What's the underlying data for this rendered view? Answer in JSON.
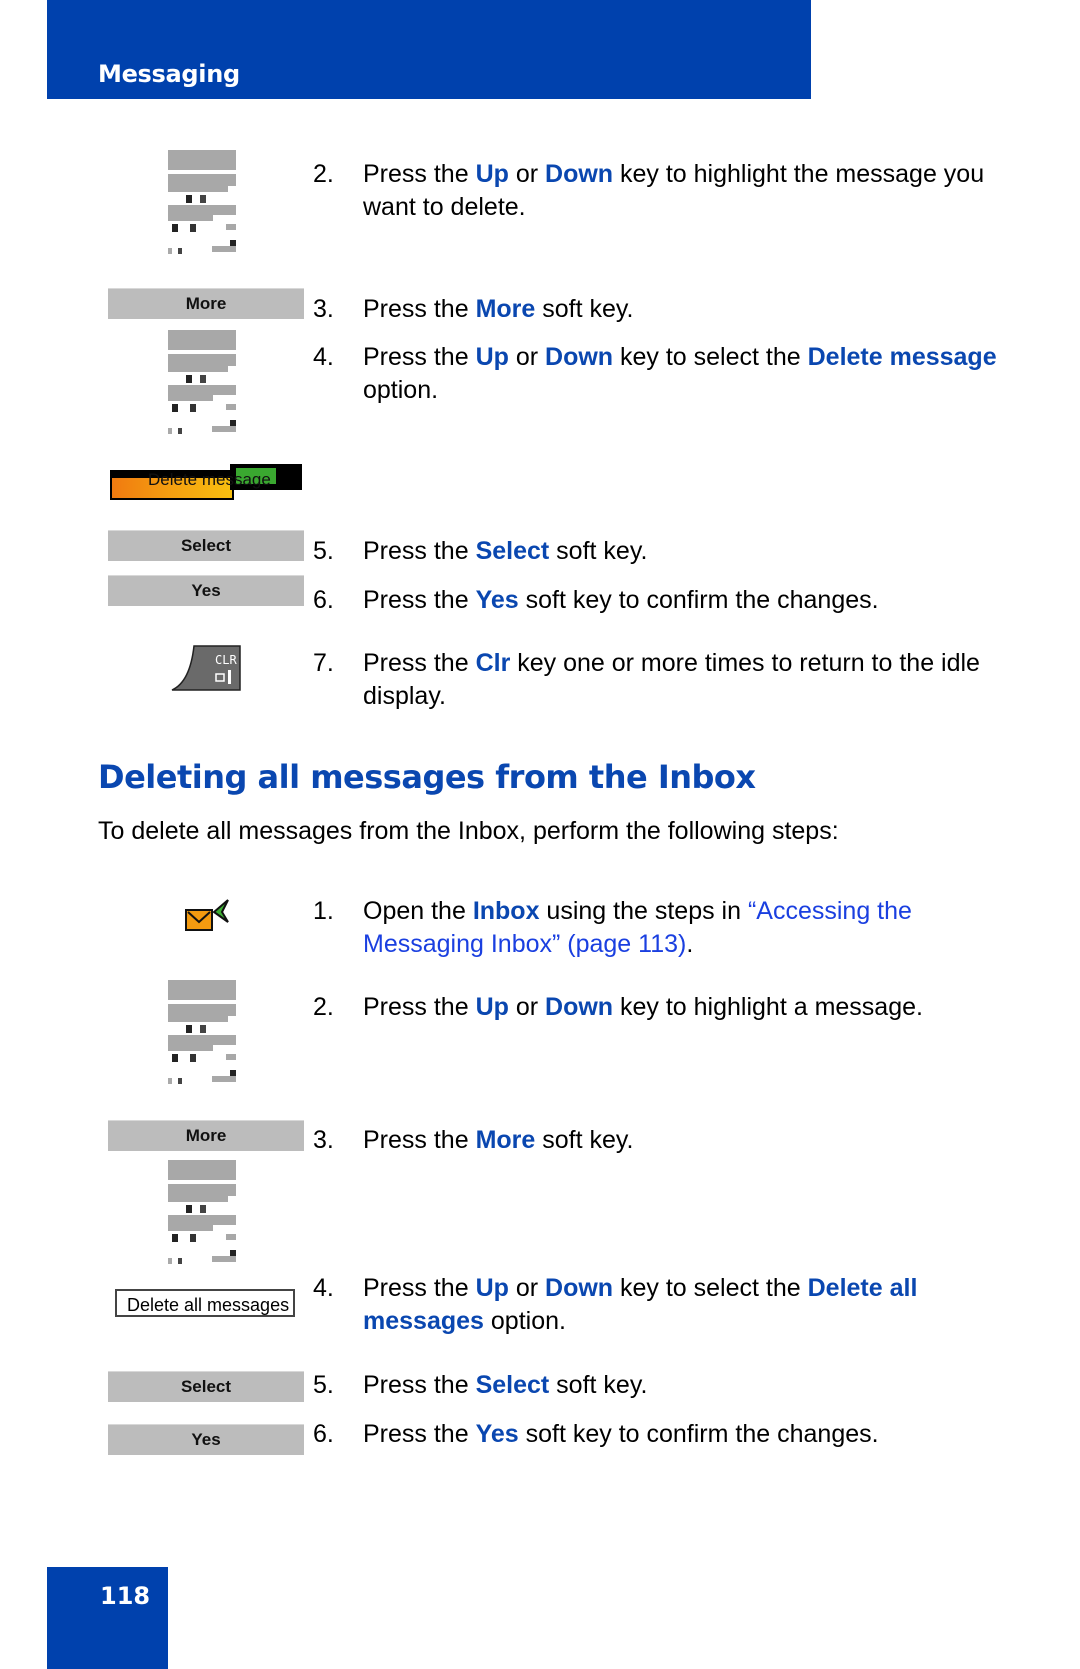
{
  "header": {
    "title": "Messaging",
    "color": "#0041ad"
  },
  "section1": {
    "steps": [
      {
        "num": "2.",
        "parts": [
          "Press the ",
          {
            "kw": "Up"
          },
          " or ",
          {
            "kw": "Down"
          },
          " key to highlight the message you want to delete."
        ]
      },
      {
        "num": "3.",
        "parts": [
          "Press the ",
          {
            "kw": "More"
          },
          " soft key."
        ]
      },
      {
        "num": "4.",
        "parts": [
          "Press the ",
          {
            "kw": "Up"
          },
          " or ",
          {
            "kw": "Down"
          },
          " key to select the ",
          {
            "kw": "Delete message"
          },
          " option."
        ]
      },
      {
        "num": "5.",
        "parts": [
          "Press the ",
          {
            "kw": "Select"
          },
          " soft key."
        ]
      },
      {
        "num": "6.",
        "parts": [
          "Press the ",
          {
            "kw": "Yes"
          },
          " soft key to confirm the changes."
        ]
      },
      {
        "num": "7.",
        "parts": [
          "Press the ",
          {
            "kw": "Clr"
          },
          " key one or more times to return to the idle display."
        ]
      }
    ],
    "softkeys": {
      "more": "More",
      "select": "Select",
      "yes": "Yes"
    },
    "highlighted_option": "Delete message",
    "clr_key_label": "CLR"
  },
  "section2": {
    "heading": "Deleting all messages from the Inbox",
    "intro": "To delete all messages from the Inbox, perform the following steps:",
    "steps": [
      {
        "num": "1.",
        "parts": [
          "Open the ",
          {
            "kw": "Inbox"
          },
          " using the steps in ",
          {
            "link": "“Accessing the Messaging Inbox” (page 113)"
          },
          "."
        ]
      },
      {
        "num": "2.",
        "parts": [
          "Press the ",
          {
            "kw": "Up"
          },
          " or ",
          {
            "kw": "Down"
          },
          " key to highlight a message."
        ]
      },
      {
        "num": "3.",
        "parts": [
          "Press the ",
          {
            "kw": "More"
          },
          " soft key."
        ]
      },
      {
        "num": "4.",
        "parts": [
          "Press the ",
          {
            "kw": "Up"
          },
          " or ",
          {
            "kw": "Down"
          },
          " key to select the ",
          {
            "kw": "Delete all messages"
          },
          " option."
        ]
      },
      {
        "num": "5.",
        "parts": [
          "Press the ",
          {
            "kw": "Select"
          },
          " soft key."
        ]
      },
      {
        "num": "6.",
        "parts": [
          "Press the ",
          {
            "kw": "Yes"
          },
          " soft key to confirm the changes."
        ]
      }
    ],
    "softkeys": {
      "more": "More",
      "select": "Select",
      "yes": "Yes"
    },
    "menu_option": "Delete all messages"
  },
  "footer": {
    "page_number": "118"
  },
  "colors": {
    "keyword": "#0a47b0",
    "link": "#1a3fe0",
    "softkey_bg": "#bcbcbc"
  }
}
